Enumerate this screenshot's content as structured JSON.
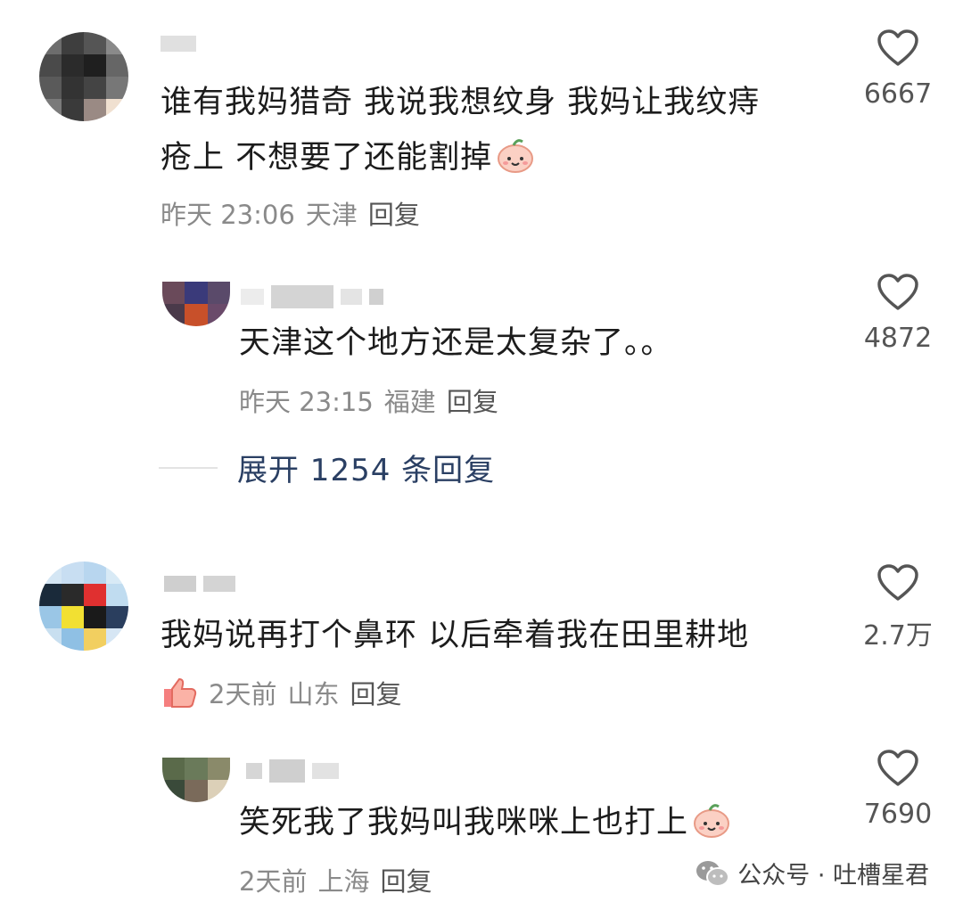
{
  "comments": [
    {
      "text_line1": "谁有我妈猎奇 我说我想纹身 我妈让我纹痔",
      "text_line2": "疮上 不想要了还能割掉",
      "time": "昨天 23:06",
      "location": "天津",
      "reply_label": "回复",
      "likes": "6667"
    },
    {
      "text_line1": "天津这个地方还是太复杂了。。",
      "time": "昨天 23:15",
      "location": "福建",
      "reply_label": "回复",
      "likes": "4872"
    },
    {
      "text_line1": "我妈说再打个鼻环 以后牵着我在田里耕地",
      "time": "2天前",
      "location": "山东",
      "reply_label": "回复",
      "likes": "2.7万"
    },
    {
      "text_line1": "笑死我了我妈叫我咪咪上也打上",
      "time": "2天前",
      "location": "上海",
      "reply_label": "回复",
      "likes": "7690"
    }
  ],
  "expand_replies": "展开 1254 条回复",
  "watermark": {
    "text": "公众号 · 吐槽星君",
    "icon": "wechat-icon"
  },
  "icons": {
    "like": "heart-outline-icon",
    "emoji": "peach-smile-icon",
    "badge": "thumbs-up-icon"
  },
  "colors": {
    "text": "#1c1c1c",
    "meta": "#8a8a8a",
    "expand_link": "#2a3f63",
    "icon_stroke": "#555555"
  }
}
